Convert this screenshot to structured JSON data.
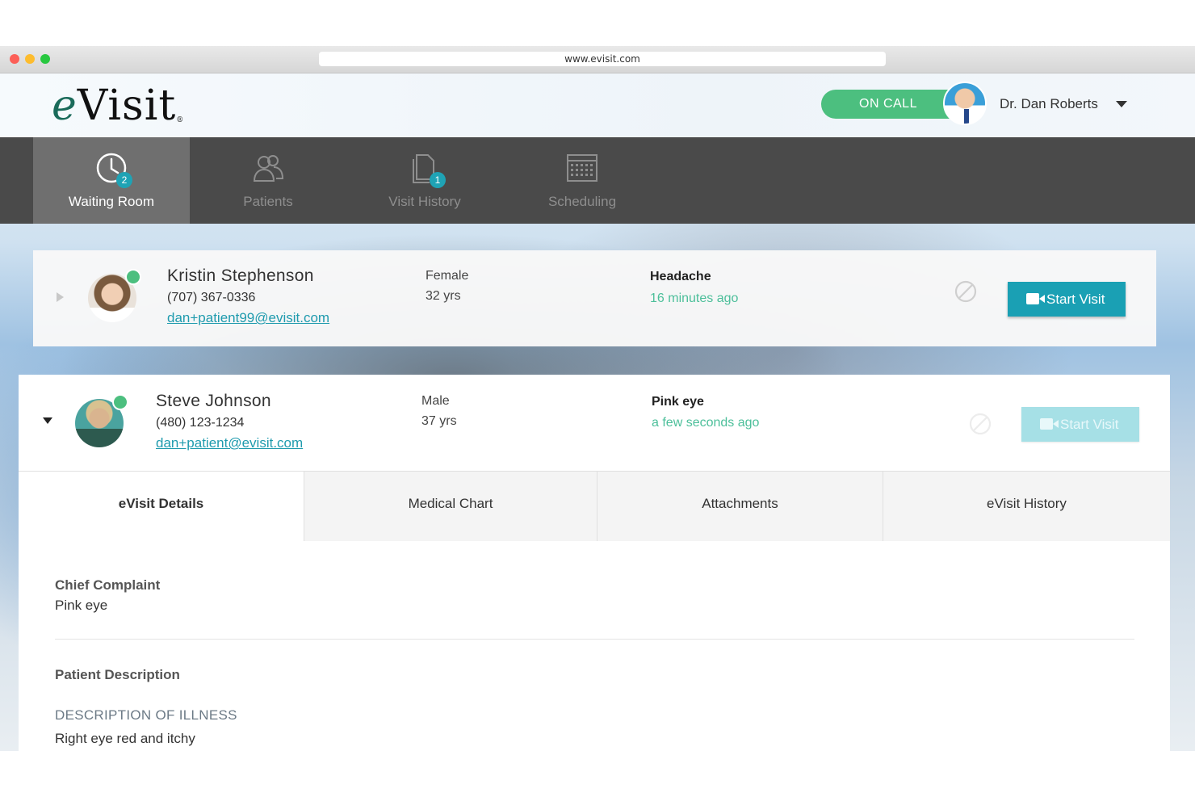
{
  "browser": {
    "url": "www.evisit.com"
  },
  "header": {
    "logo_e": "e",
    "logo_rest": "Visit",
    "logo_mark": "®",
    "status_label": "ON CALL",
    "user_name": "Dr. Dan Roberts"
  },
  "nav": {
    "tabs": [
      {
        "label": "Waiting Room",
        "icon": "clock-icon",
        "badge": "2",
        "active": true
      },
      {
        "label": "Patients",
        "icon": "people-icon",
        "badge": "",
        "active": false
      },
      {
        "label": "Visit History",
        "icon": "document-icon",
        "badge": "1",
        "active": false
      },
      {
        "label": "Scheduling",
        "icon": "calendar-icon",
        "badge": "",
        "active": false
      }
    ]
  },
  "patients": [
    {
      "name": "Kristin Stephenson",
      "phone": "(707) 367-0336",
      "email": "dan+patient99@evisit.com",
      "gender": "Female",
      "age": "32 yrs",
      "complaint": "Headache",
      "waiting": "16 minutes ago",
      "start_label": "Start Visit",
      "expanded": false
    },
    {
      "name": "Steve Johnson",
      "phone": "(480) 123-1234",
      "email": "dan+patient@evisit.com",
      "gender": "Male",
      "age": "37 yrs",
      "complaint": "Pink eye",
      "waiting": "a few seconds ago",
      "start_label": "Start Visit",
      "expanded": true
    }
  ],
  "detail_tabs": [
    "eVisit Details",
    "Medical Chart",
    "Attachments",
    "eVisit History"
  ],
  "details": {
    "chief_complaint_label": "Chief Complaint",
    "chief_complaint_value": "Pink eye",
    "patient_description_label": "Patient Description",
    "description_of_illness_label": "DESCRIPTION OF ILLNESS",
    "description_of_illness_value": "Right eye red and itchy"
  },
  "colors": {
    "accent": "#1aa0b4",
    "online": "#4cbf7f",
    "nav_bg": "#4a4a4a",
    "nav_active": "#6f6f6f"
  }
}
